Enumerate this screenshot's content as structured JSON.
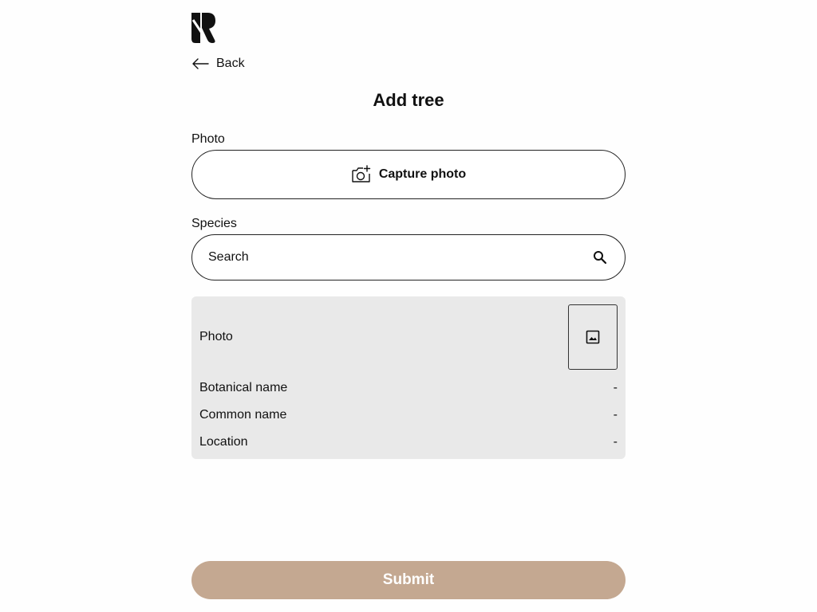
{
  "header": {
    "logo_icon": "brand-logo-icon",
    "back_label": "Back",
    "back_icon": "arrow-left-icon"
  },
  "page": {
    "title": "Add tree"
  },
  "photo_field": {
    "label": "Photo",
    "button_label": "Capture photo",
    "button_icon": "camera-add-icon"
  },
  "species_field": {
    "label": "Species",
    "placeholder": "Search",
    "value": "",
    "icon": "search-icon"
  },
  "details": {
    "photo_label": "Photo",
    "photo_icon": "image-icon",
    "rows": [
      {
        "label": "Botanical name",
        "value": "-"
      },
      {
        "label": "Common name",
        "value": "-"
      },
      {
        "label": "Location",
        "value": "-"
      }
    ],
    "background": "#e9e9e9"
  },
  "submit": {
    "label": "Submit",
    "color": "#c4a891"
  }
}
